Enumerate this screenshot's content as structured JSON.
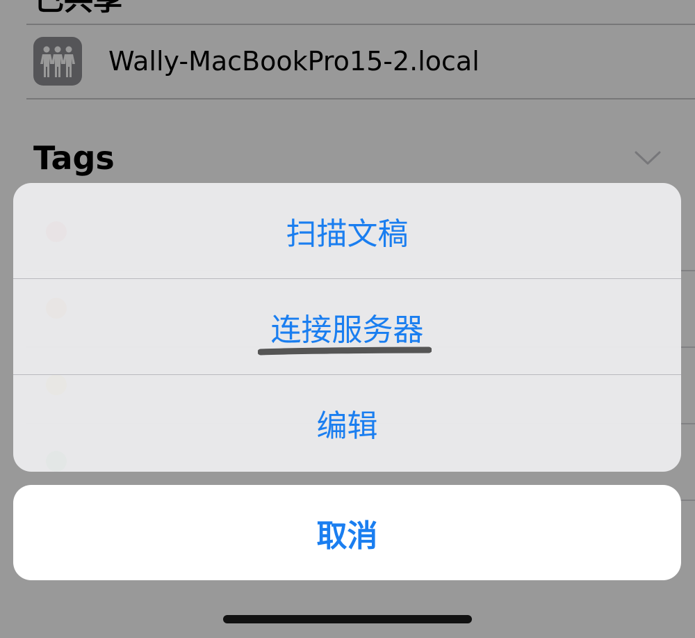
{
  "background": {
    "section_title": "已共享",
    "server": {
      "name": "Wally-MacBookPro15-2.local",
      "icon": "shared-people-icon"
    },
    "tags": {
      "title": "Tags",
      "chevron_icon": "chevron-down-icon",
      "dot_colors": [
        "#ff3b30",
        "#ff9500",
        "#ffcc00",
        "#34c759"
      ]
    }
  },
  "action_sheet": {
    "actions": [
      {
        "label": "扫描文稿"
      },
      {
        "label": "连接服务器"
      },
      {
        "label": "编辑"
      }
    ],
    "cancel_label": "取消"
  },
  "colors": {
    "accent": "#1a7ef0",
    "overlay": "rgba(0,0,0,0.40)"
  }
}
